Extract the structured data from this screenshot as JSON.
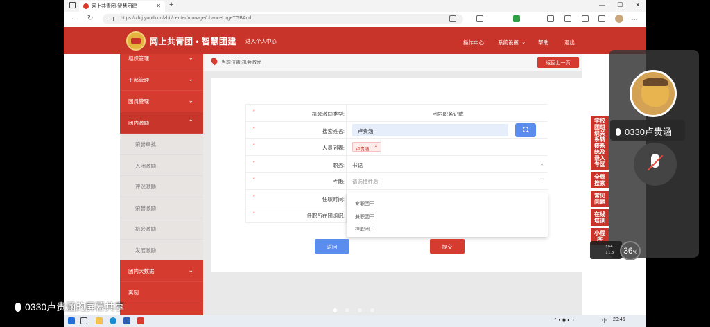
{
  "browser": {
    "tab_title": "网上共青团·智慧团建",
    "url": "https://zhtj.youth.cn/zhtj/center/manage/chanceUrgeTGBAdd"
  },
  "header": {
    "site_title": "网上共青团 • 智慧团建",
    "personal_center": "进入个人中心",
    "links": {
      "help_center": "操作中心",
      "settings": "系统设置",
      "help": "帮助",
      "logout": "退出"
    }
  },
  "sidebar": {
    "items": [
      {
        "label": "组织管理"
      },
      {
        "label": "干部管理"
      },
      {
        "label": "团员管理"
      },
      {
        "label": "团内激励"
      }
    ],
    "sub_items": [
      "荣誉审批",
      "入团激励",
      "评议激励",
      "荣誉激励",
      "机会激励",
      "发展激励"
    ],
    "bottom_items": [
      {
        "label": "团内大数据"
      },
      {
        "label": "离制"
      }
    ]
  },
  "main": {
    "breadcrumb": "当前位置:机会激励",
    "back_button": "返回上一页",
    "form": {
      "type_label": "机会激励类型:",
      "type_value": "团内职务记载",
      "name_label": "搜索姓名:",
      "name_value": "卢贵涵",
      "list_label": "人员列表:",
      "list_tag": "卢贵涵",
      "position_label": "职务:",
      "position_value": "书记",
      "nature_label": "性质:",
      "nature_placeholder": "请选择性质",
      "term_label": "任职时间:",
      "org_label": "任职所在团组织:"
    },
    "dropdown_options": [
      "专职团干",
      "兼职团干",
      "挂职团干"
    ],
    "return_button": "返回",
    "submit_button": "提交"
  },
  "side_nav": [
    "学校团组织关系转接系统及录入专区",
    "全局搜索",
    "常见问题",
    "在线培训",
    "小程序"
  ],
  "meeting": {
    "participant_name": "0330卢贵涵",
    "share_label": "0330卢贵涵的屏幕共享",
    "net_up": "64",
    "net_down": "1.8",
    "cpu_percent": "36"
  },
  "taskbar": {
    "time": "20:46",
    "ime": "中"
  },
  "colors": {
    "brand_red": "#c9342a",
    "accent_blue": "#5b8def"
  }
}
